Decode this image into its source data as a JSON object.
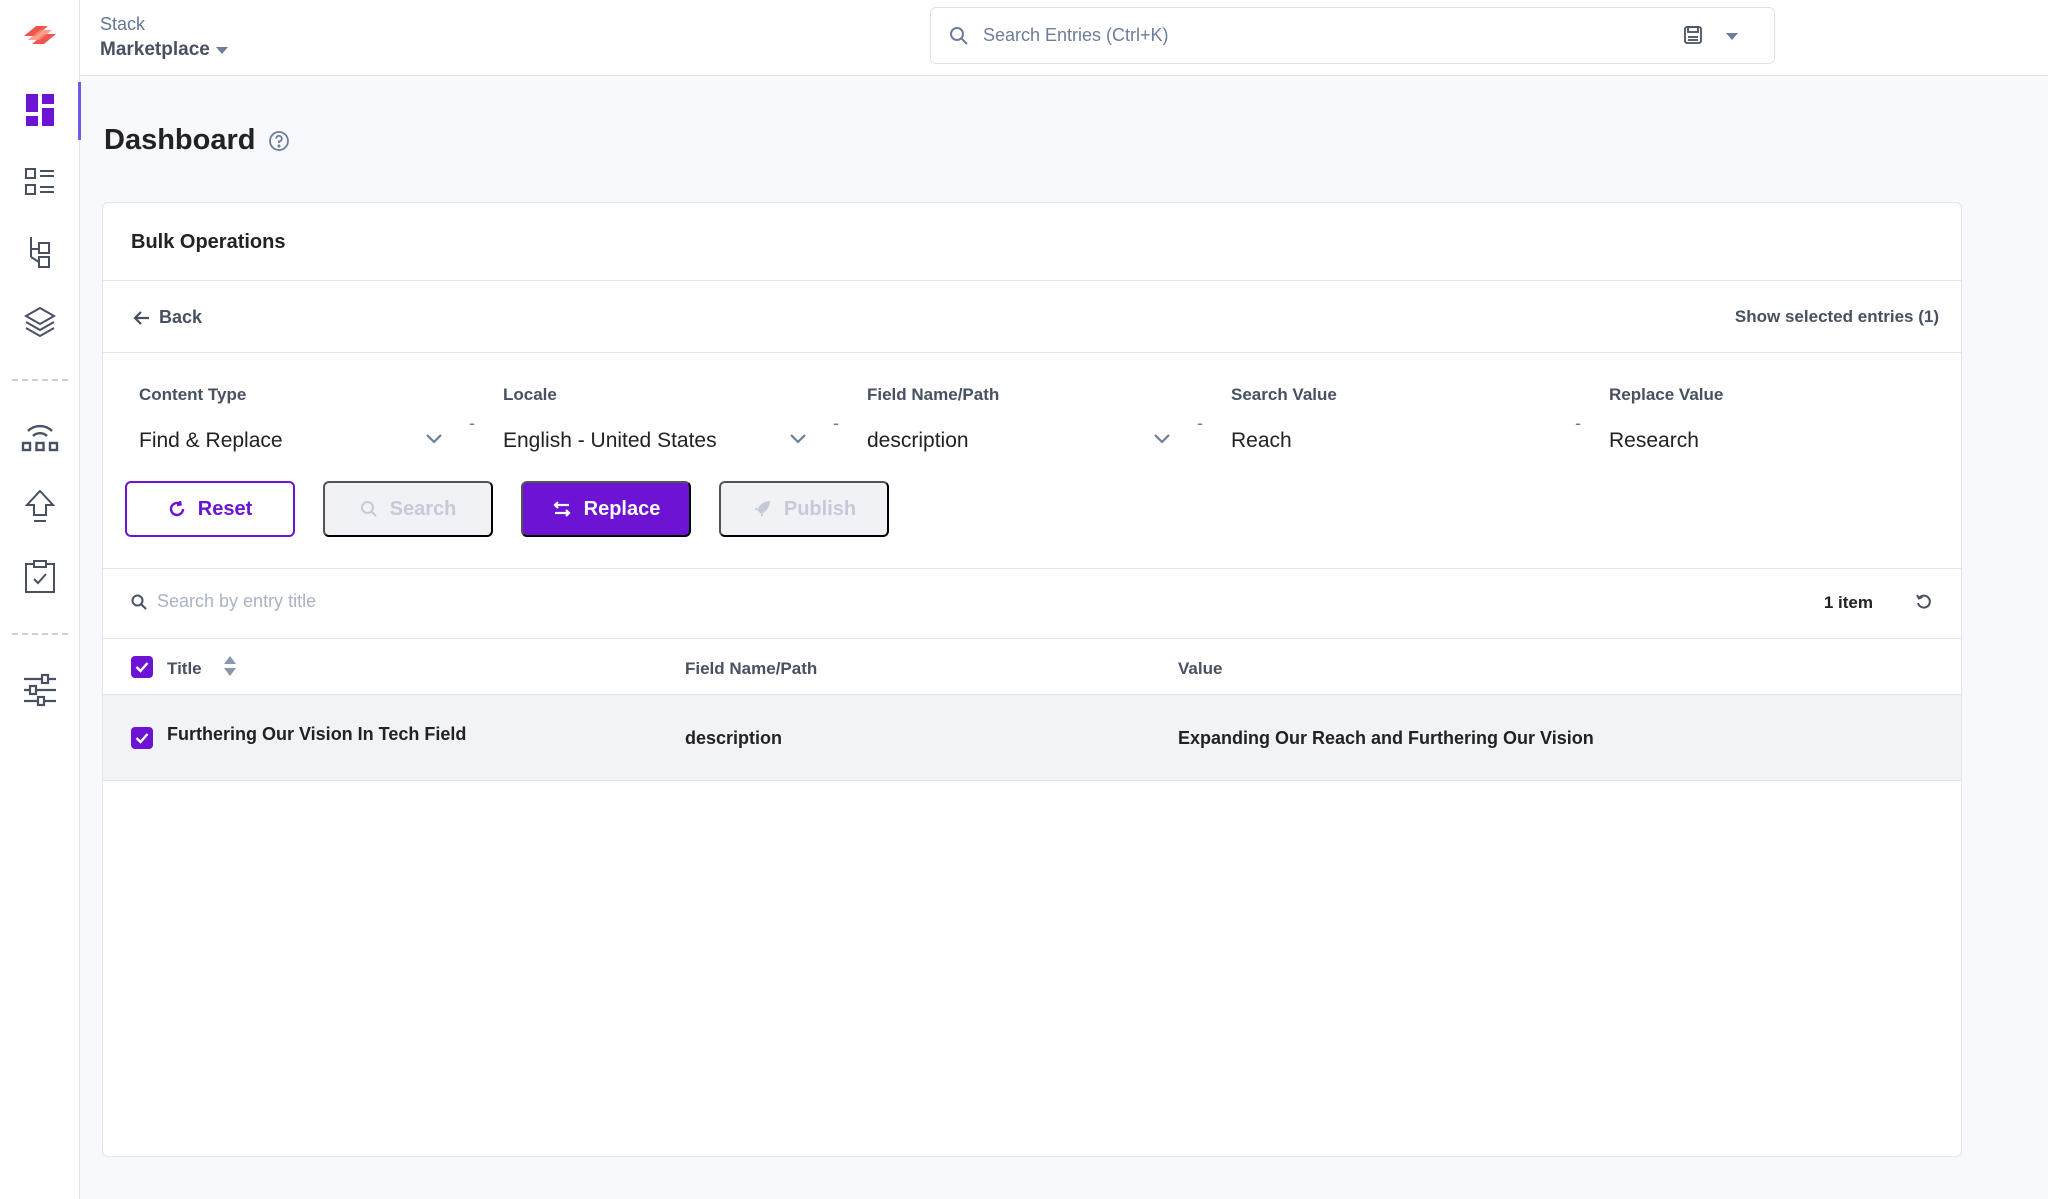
{
  "topbar": {
    "stack_label": "Stack",
    "stack_name": "Marketplace",
    "search_placeholder": "Search Entries (Ctrl+K)"
  },
  "sidebar": {
    "items": [
      {
        "icon": "dashboard-icon",
        "active": true
      },
      {
        "icon": "entries-list-icon",
        "active": false
      },
      {
        "icon": "content-models-icon",
        "active": false
      },
      {
        "icon": "layers-icon",
        "active": false
      },
      {
        "icon": "releases-icon",
        "active": false
      },
      {
        "icon": "publish-queue-icon",
        "active": false
      },
      {
        "icon": "tasks-icon",
        "active": false
      },
      {
        "icon": "settings-sliders-icon",
        "active": false
      }
    ]
  },
  "page": {
    "title": "Dashboard"
  },
  "card": {
    "title": "Bulk Operations",
    "back_label": "Back",
    "show_selected_label": "Show selected entries (1)",
    "filters": {
      "content_type": {
        "label": "Content Type",
        "value": "Find & Replace"
      },
      "locale": {
        "label": "Locale",
        "value": "English - United States"
      },
      "field_path": {
        "label": "Field Name/Path",
        "value": "description"
      },
      "search_value": {
        "label": "Search Value",
        "value": "Reach"
      },
      "replace_value": {
        "label": "Replace Value",
        "value": "Research"
      },
      "separator": "-"
    },
    "buttons": {
      "reset": "Reset",
      "search": "Search",
      "replace": "Replace",
      "publish": "Publish"
    },
    "table": {
      "search_placeholder": "Search by entry title",
      "item_count": "1 item",
      "columns": [
        "Title",
        "Field Name/Path",
        "Value"
      ],
      "rows": [
        {
          "selected": true,
          "title": "Furthering Our Vision In Tech Field",
          "field_path": "description",
          "value": "Expanding Our Reach and Furthering Our Vision"
        }
      ]
    }
  },
  "colors": {
    "accent": "#6c13d4",
    "rail_active": "#6c5ce7",
    "text_muted": "#475161",
    "disabled_bg": "#f0f2f6",
    "row_bg": "#f2f3f6"
  }
}
